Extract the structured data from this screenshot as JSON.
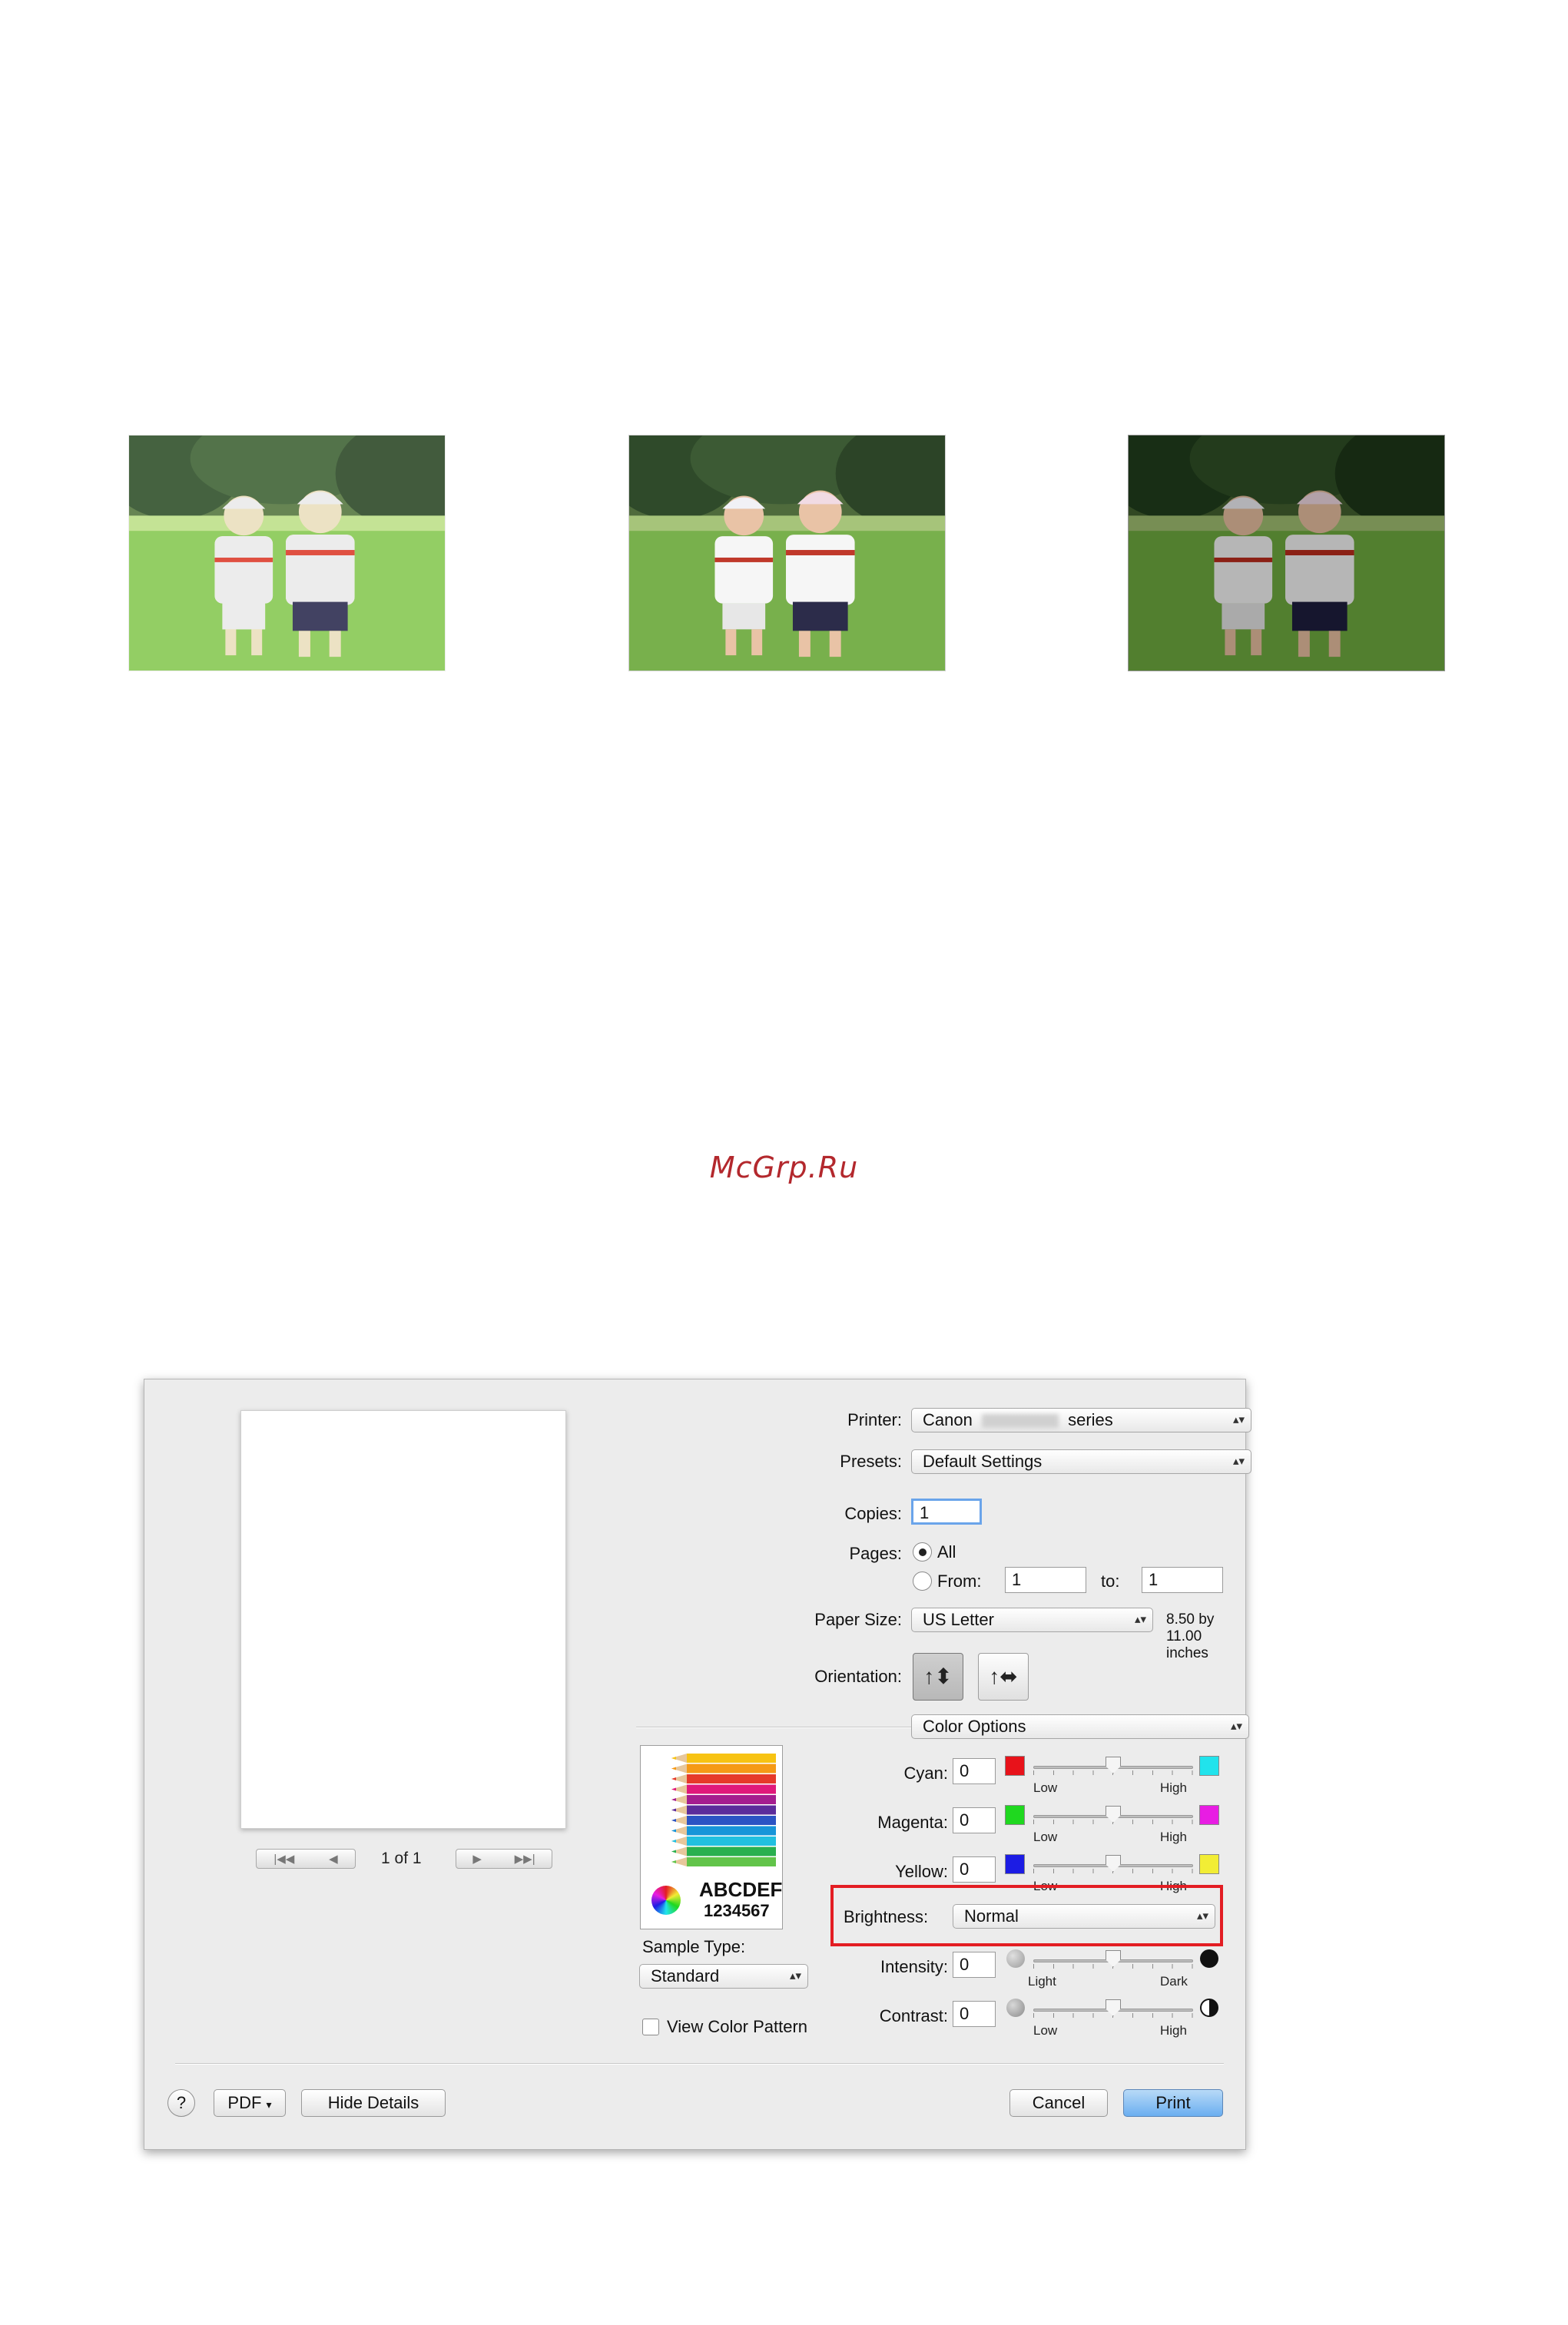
{
  "watermark": "McGrp.Ru",
  "photos": [
    {
      "label": "",
      "brightness": "light"
    },
    {
      "label": "",
      "brightness": "normal"
    },
    {
      "label": "",
      "brightness": "dark"
    }
  ],
  "dialog": {
    "preview": {
      "page_count": "1 of 1"
    },
    "printer": {
      "label": "Printer:",
      "value_prefix": "Canon",
      "value_suffix": "series"
    },
    "presets": {
      "label": "Presets:",
      "value": "Default Settings"
    },
    "copies": {
      "label": "Copies:",
      "value": "1"
    },
    "pages": {
      "label": "Pages:",
      "all": "All",
      "from": "From:",
      "from_value": "1",
      "to": "to:",
      "to_value": "1"
    },
    "paper_size": {
      "label": "Paper Size:",
      "value": "US Letter",
      "dimensions": "8.50 by 11.00 inches"
    },
    "orientation": {
      "label": "Orientation:"
    },
    "panel": {
      "value": "Color Options"
    },
    "sample": {
      "text1": "ABCDEF",
      "text2": "1234567"
    },
    "sample_type": {
      "label": "Sample Type:",
      "value": "Standard"
    },
    "view_color_pattern": "View Color Pattern",
    "cyan": {
      "label": "Cyan:",
      "value": "0",
      "low": "Low",
      "high": "High",
      "level": 0.5
    },
    "magenta": {
      "label": "Magenta:",
      "value": "0",
      "low": "Low",
      "high": "High",
      "level": 0.5
    },
    "yellow": {
      "label": "Yellow:",
      "value": "0",
      "low": "Low",
      "high": "High",
      "level": 0.5
    },
    "brightness": {
      "label": "Brightness:",
      "value": "Normal"
    },
    "intensity": {
      "label": "Intensity:",
      "value": "0",
      "low": "Light",
      "high": "Dark",
      "level": 0.5
    },
    "contrast": {
      "label": "Contrast:",
      "value": "0",
      "low": "Low",
      "high": "High",
      "level": 0.5
    },
    "buttons": {
      "help": "?",
      "pdf": "PDF",
      "hide_details": "Hide Details",
      "cancel": "Cancel",
      "print": "Print"
    },
    "colors": {
      "cyan_low": "#e8121a",
      "cyan_high": "#21e3ec",
      "magenta_low": "#1fd81f",
      "magenta_high": "#e81de3",
      "yellow_low": "#1c1ce4",
      "yellow_high": "#f2ed35",
      "highlight": "#e31d23"
    }
  }
}
